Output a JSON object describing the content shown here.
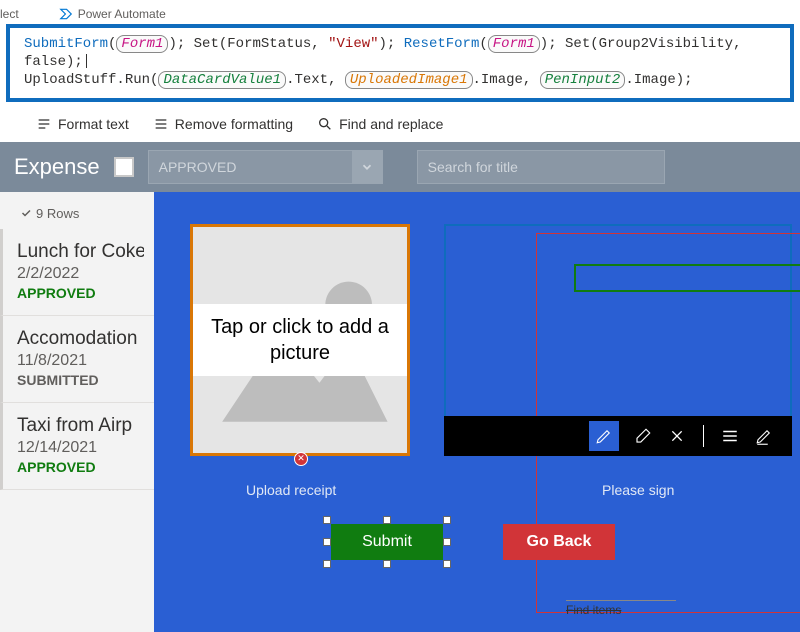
{
  "topTabs": {
    "select": "lect",
    "powerAutomate": "Power Automate"
  },
  "formula": {
    "submitForm": "SubmitForm",
    "form1a": "Form1",
    "set1": "Set",
    "formStatusVar": "FormStatus",
    "viewStr": "\"View\"",
    "resetForm": "ResetForm",
    "form1b": "Form1",
    "set2": "Set",
    "group2Var": "Group2Visibility",
    "falseKw": "false",
    "uploadStuff": "UploadStuff.Run",
    "dc": "DataCardValue1",
    "dcText": ".Text, ",
    "img": "UploadedImage1",
    "imgImage": ".Image, ",
    "pen": "PenInput2",
    "penImage": ".Image);"
  },
  "toolbar": {
    "format": "Format text",
    "remove": "Remove formatting",
    "find": "Find and replace"
  },
  "header": {
    "title": "Expense",
    "ddValue": "APPROVED",
    "searchPlaceholder": "Search for title"
  },
  "rows": {
    "label": "9 Rows"
  },
  "list": [
    {
      "title": "Lunch for Coke",
      "date": "2/2/2022",
      "status": "APPROVED",
      "statusClass": "st-approved"
    },
    {
      "title": "Accomodation",
      "date": "11/8/2021",
      "status": "SUBMITTED",
      "statusClass": "st-submitted"
    },
    {
      "title": "Taxi from Airp",
      "date": "12/14/2021",
      "status": "APPROVED",
      "statusClass": "st-approved"
    }
  ],
  "canvas": {
    "uploadText": "Tap or click to add a picture",
    "uploadLabel": "Upload receipt",
    "signLabel": "Please sign",
    "submit": "Submit",
    "goBack": "Go Back",
    "findItems": "Find items"
  }
}
